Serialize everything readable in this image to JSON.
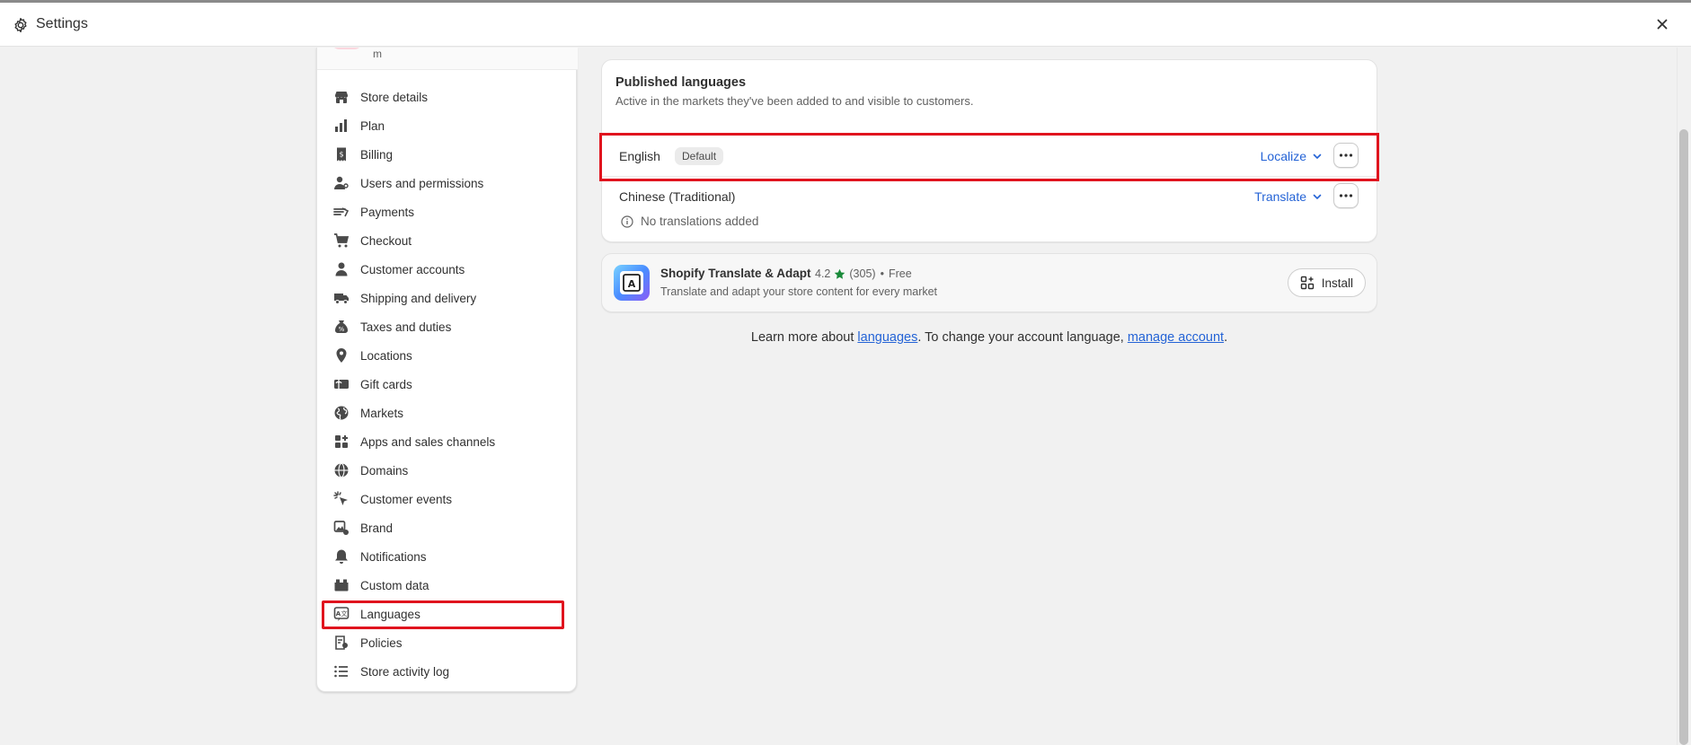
{
  "window": {
    "title": "Settings"
  },
  "sidebar": {
    "shop_tail": "m",
    "items": [
      {
        "label": "Store details",
        "icon": "store-icon"
      },
      {
        "label": "Plan",
        "icon": "plan-icon"
      },
      {
        "label": "Billing",
        "icon": "billing-icon"
      },
      {
        "label": "Users and permissions",
        "icon": "users-icon"
      },
      {
        "label": "Payments",
        "icon": "payments-icon"
      },
      {
        "label": "Checkout",
        "icon": "cart-icon"
      },
      {
        "label": "Customer accounts",
        "icon": "person-icon"
      },
      {
        "label": "Shipping and delivery",
        "icon": "truck-icon"
      },
      {
        "label": "Taxes and duties",
        "icon": "money-bag-icon"
      },
      {
        "label": "Locations",
        "icon": "location-pin-icon"
      },
      {
        "label": "Gift cards",
        "icon": "gift-card-icon"
      },
      {
        "label": "Markets",
        "icon": "globe-icon"
      },
      {
        "label": "Apps and sales channels",
        "icon": "apps-icon"
      },
      {
        "label": "Domains",
        "icon": "domain-globe-icon"
      },
      {
        "label": "Customer events",
        "icon": "cursor-click-icon"
      },
      {
        "label": "Brand",
        "icon": "brand-icon"
      },
      {
        "label": "Notifications",
        "icon": "bell-icon"
      },
      {
        "label": "Custom data",
        "icon": "database-icon"
      },
      {
        "label": "Languages",
        "icon": "language-icon",
        "active": true
      },
      {
        "label": "Policies",
        "icon": "policy-icon"
      },
      {
        "label": "Store activity log",
        "icon": "list-icon"
      }
    ]
  },
  "languages_card": {
    "title": "Published languages",
    "subtitle": "Active in the markets they've been added to and visible to customers.",
    "rows": [
      {
        "name": "English",
        "badge": "Default",
        "action": "Localize"
      },
      {
        "name": "Chinese (Traditional)",
        "action": "Translate",
        "note": "No translations added"
      }
    ]
  },
  "app_card": {
    "name": "Shopify Translate & Adapt",
    "rating": "4.2",
    "reviews": "(305)",
    "separator": "•",
    "price": "Free",
    "description": "Translate and adapt your store content for every market",
    "install_label": "Install"
  },
  "footer": {
    "prefix": "Learn more about ",
    "link1": "languages",
    "middle": ". To change your account language, ",
    "link2": "manage account",
    "suffix": "."
  },
  "colors": {
    "link": "#2463d6",
    "highlight": "#e0141e",
    "star": "#1a8a3a"
  }
}
